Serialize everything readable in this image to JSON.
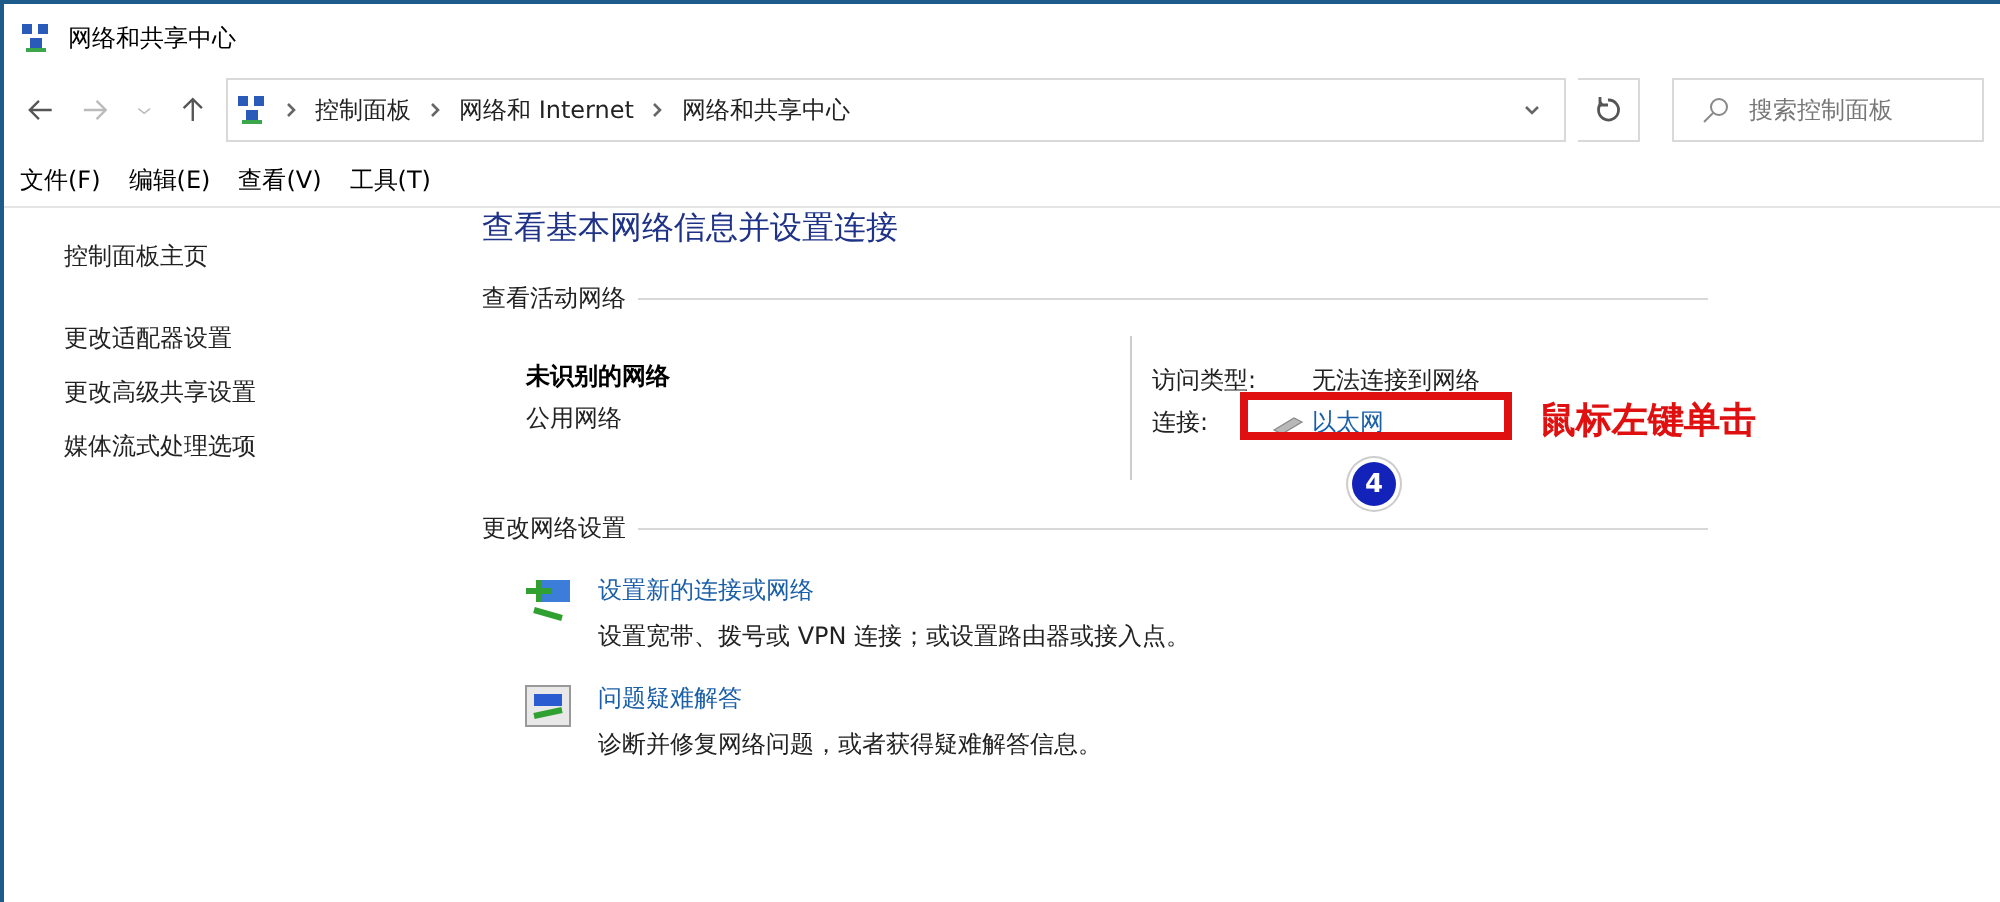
{
  "window": {
    "title": "网络和共享中心"
  },
  "address_bar": {
    "breadcrumbs": [
      "控制面板",
      "网络和 Internet",
      "网络和共享中心"
    ]
  },
  "search": {
    "placeholder": "搜索控制面板"
  },
  "menu": [
    "文件(F)",
    "编辑(E)",
    "查看(V)",
    "工具(T)"
  ],
  "sidebar": {
    "items": [
      {
        "label": "控制面板主页",
        "kind": "home"
      },
      {
        "label": "更改适配器设置",
        "kind": "link"
      },
      {
        "label": "更改高级共享设置",
        "kind": "link"
      },
      {
        "label": "媒体流式处理选项",
        "kind": "link"
      }
    ]
  },
  "heading": "查看基本网络信息并设置连接",
  "active_networks": {
    "title": "查看活动网络",
    "network_name": "未识别的网络",
    "network_type": "公用网络",
    "access_label": "访问类型:",
    "access_value": "无法连接到网络",
    "connection_label": "连接:",
    "connection_link": "以太网"
  },
  "annotation": {
    "text": "鼠标左键单击",
    "step": "4"
  },
  "change_settings": {
    "title": "更改网络设置",
    "items": [
      {
        "kind": "new-connection",
        "link": "设置新的连接或网络",
        "description": "设置宽带、拨号或 VPN 连接；或设置路由器或接入点。"
      },
      {
        "kind": "troubleshoot",
        "link": "问题疑难解答",
        "description": "诊断并修复网络问题，或者获得疑难解答信息。"
      }
    ]
  }
}
